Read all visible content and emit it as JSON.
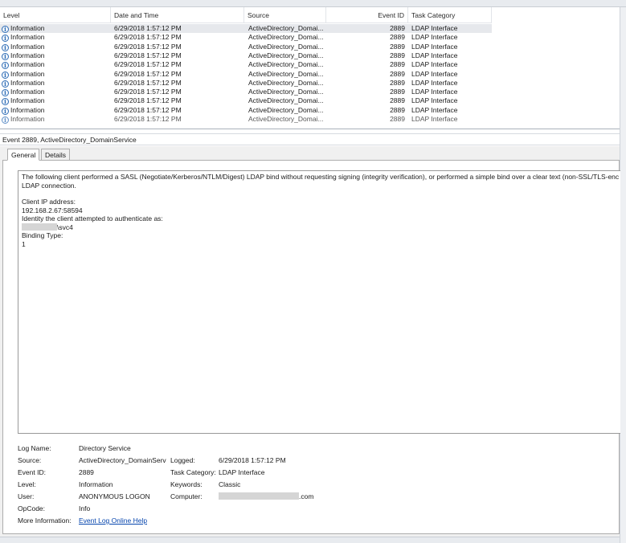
{
  "list": {
    "columns": {
      "level": "Level",
      "date": "Date and Time",
      "source": "Source",
      "event_id": "Event ID",
      "category": "Task Category"
    },
    "rows": [
      {
        "level": "Information",
        "date": "6/29/2018 1:57:12 PM",
        "source": "ActiveDirectory_Domai...",
        "event_id": "2889",
        "category": "LDAP Interface"
      },
      {
        "level": "Information",
        "date": "6/29/2018 1:57:12 PM",
        "source": "ActiveDirectory_Domai...",
        "event_id": "2889",
        "category": "LDAP Interface"
      },
      {
        "level": "Information",
        "date": "6/29/2018 1:57:12 PM",
        "source": "ActiveDirectory_Domai...",
        "event_id": "2889",
        "category": "LDAP Interface"
      },
      {
        "level": "Information",
        "date": "6/29/2018 1:57:12 PM",
        "source": "ActiveDirectory_Domai...",
        "event_id": "2889",
        "category": "LDAP Interface"
      },
      {
        "level": "Information",
        "date": "6/29/2018 1:57:12 PM",
        "source": "ActiveDirectory_Domai...",
        "event_id": "2889",
        "category": "LDAP Interface"
      },
      {
        "level": "Information",
        "date": "6/29/2018 1:57:12 PM",
        "source": "ActiveDirectory_Domai...",
        "event_id": "2889",
        "category": "LDAP Interface"
      },
      {
        "level": "Information",
        "date": "6/29/2018 1:57:12 PM",
        "source": "ActiveDirectory_Domai...",
        "event_id": "2889",
        "category": "LDAP Interface"
      },
      {
        "level": "Information",
        "date": "6/29/2018 1:57:12 PM",
        "source": "ActiveDirectory_Domai...",
        "event_id": "2889",
        "category": "LDAP Interface"
      },
      {
        "level": "Information",
        "date": "6/29/2018 1:57:12 PM",
        "source": "ActiveDirectory_Domai...",
        "event_id": "2889",
        "category": "LDAP Interface"
      },
      {
        "level": "Information",
        "date": "6/29/2018 1:57:12 PM",
        "source": "ActiveDirectory_Domai...",
        "event_id": "2889",
        "category": "LDAP Interface"
      },
      {
        "level": "Information",
        "date": "6/29/2018 1:57:12 PM",
        "source": "ActiveDirectory_Domai...",
        "event_id": "2889",
        "category": "LDAP Interface"
      }
    ]
  },
  "detail": {
    "title": "Event 2889, ActiveDirectory_DomainService",
    "tabs": {
      "general": "General",
      "details": "Details"
    },
    "message": {
      "line1": "The following client performed a SASL (Negotiate/Kerberos/NTLM/Digest) LDAP bind without requesting signing (integrity verification), or performed a simple bind over a clear text (non-SSL/TLS-enc",
      "line2": "LDAP connection.",
      "ip_label": "Client IP address:",
      "ip_value": "192.168.2.67:58594",
      "identity_label": "Identity the client attempted to authenticate as:",
      "identity_value": "\\svc4",
      "binding_label": "Binding Type:",
      "binding_value": "1"
    },
    "props": {
      "log_name_label": "Log Name:",
      "log_name": "Directory Service",
      "source_label": "Source:",
      "source": "ActiveDirectory_DomainServ",
      "logged_label": "Logged:",
      "logged": "6/29/2018 1:57:12 PM",
      "event_id_label": "Event ID:",
      "event_id": "2889",
      "task_category_label": "Task Category:",
      "task_category": "LDAP Interface",
      "level_label": "Level:",
      "level": "Information",
      "keywords_label": "Keywords:",
      "keywords": "Classic",
      "user_label": "User:",
      "user": "ANONYMOUS LOGON",
      "computer_label": "Computer:",
      "computer_suffix": ".com",
      "opcode_label": "OpCode:",
      "opcode": "Info",
      "more_info_label": "More Information:",
      "more_info_link": "Event Log Online Help"
    }
  }
}
